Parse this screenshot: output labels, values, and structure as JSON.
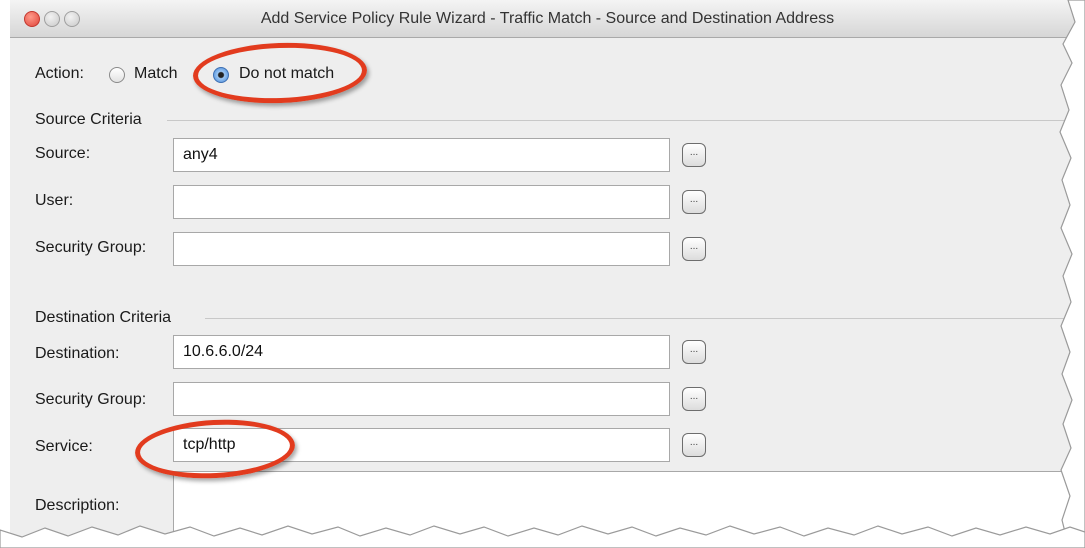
{
  "window": {
    "title": "Add Service Policy Rule Wizard - Traffic Match - Source and Destination Address"
  },
  "action": {
    "label": "Action:",
    "match_label": "Match",
    "do_not_match_label": "Do not match",
    "selected": "Do not match"
  },
  "source": {
    "heading": "Source Criteria",
    "source_label": "Source:",
    "source_value": "any4",
    "user_label": "User:",
    "user_value": "",
    "security_group_label": "Security Group:",
    "security_group_value": ""
  },
  "destination": {
    "heading": "Destination Criteria",
    "destination_label": "Destination:",
    "destination_value": "10.6.6.0/24",
    "security_group_label": "Security Group:",
    "security_group_value": "",
    "service_label": "Service:",
    "service_value": "tcp/http"
  },
  "description": {
    "label": "Description:",
    "value": ""
  },
  "browse_button_label": "...",
  "colors": {
    "highlight_ring": "#e23b1e",
    "window_background": "#eeeeee"
  }
}
